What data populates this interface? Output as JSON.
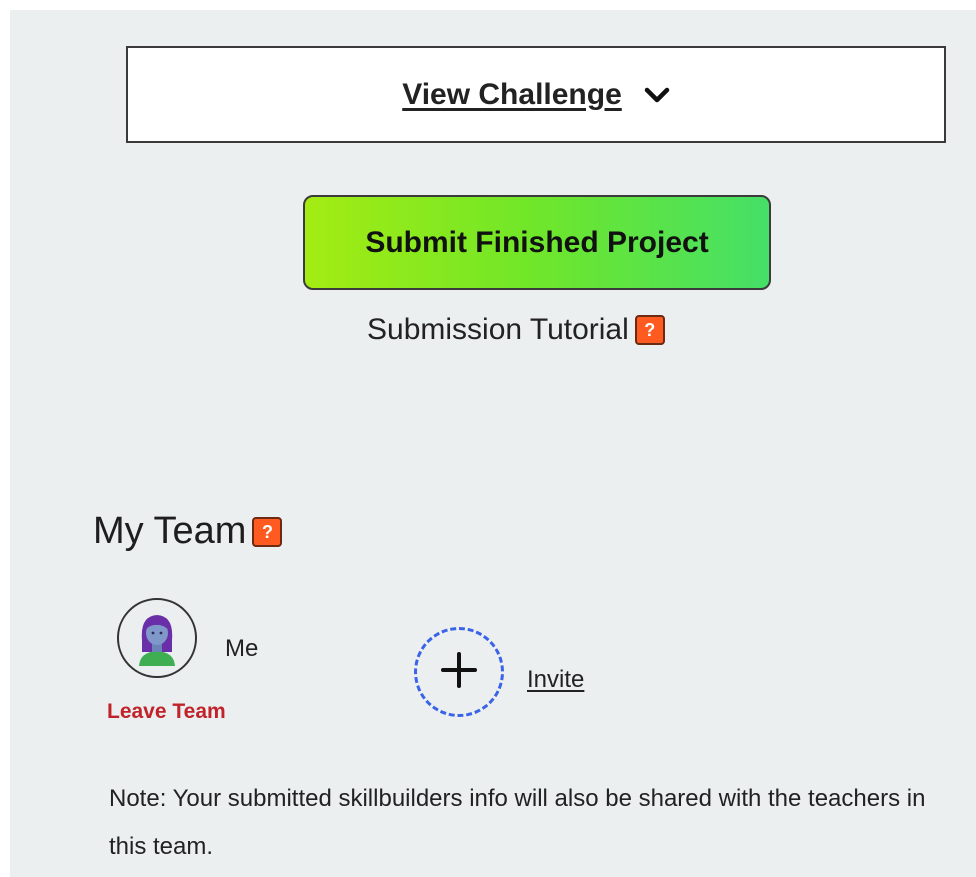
{
  "challenge": {
    "label": "View Challenge",
    "icon": "chevron-down-icon"
  },
  "submit": {
    "label": "Submit Finished Project"
  },
  "tutorial": {
    "label": "Submission Tutorial",
    "help_symbol": "?"
  },
  "team": {
    "heading": "My Team",
    "help_symbol": "?",
    "member": {
      "name": "Me",
      "leave_label": "Leave Team",
      "avatar_icon": "user-avatar-icon"
    },
    "invite": {
      "label": "Invite",
      "icon": "plus-icon"
    }
  },
  "note": "Note: Your submitted skillbuilders info will also be shared with the teachers in this team.",
  "colors": {
    "background": "#ebeff0",
    "submit_gradient_start": "#a4ec12",
    "submit_gradient_end": "#45e068",
    "help_badge": "#ff5a1f",
    "leave_team": "#c0232a",
    "invite_border": "#3b63e8"
  }
}
